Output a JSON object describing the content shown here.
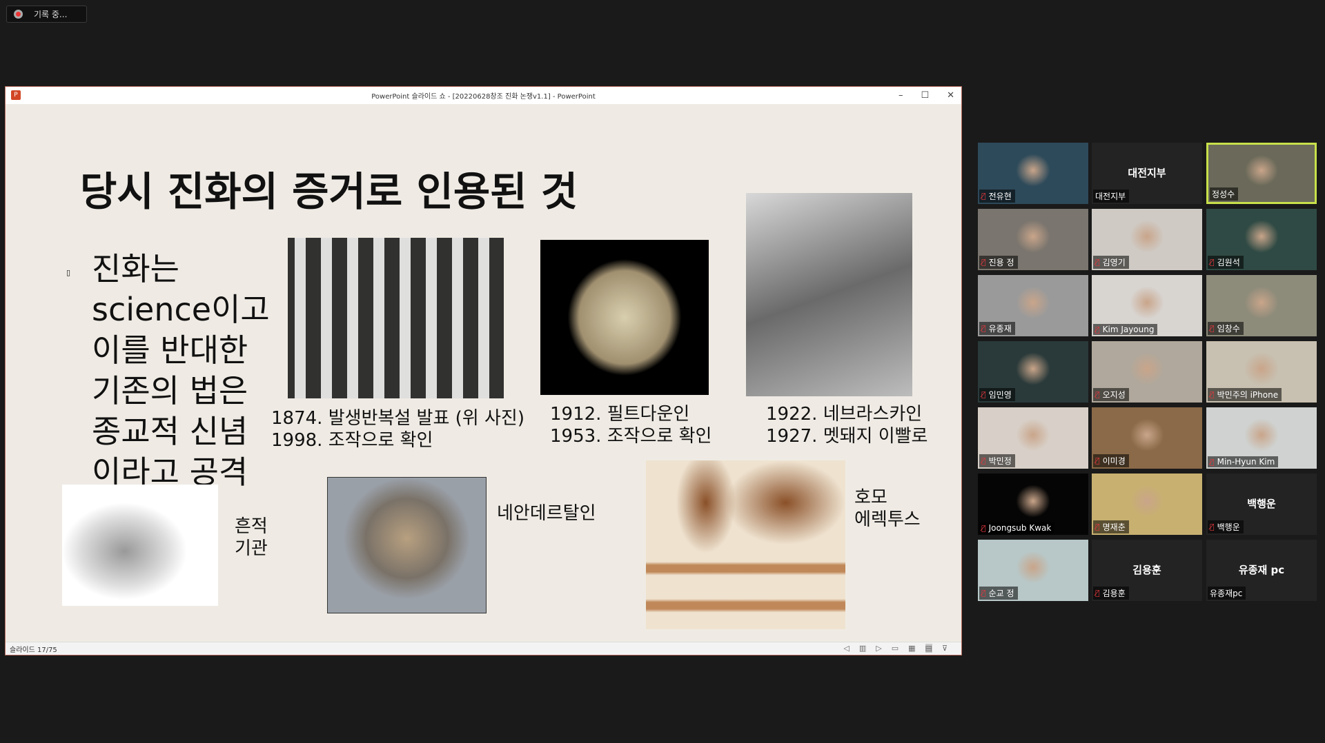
{
  "recording": {
    "label": "기록 중..."
  },
  "window": {
    "title": "PowerPoint 슬라이드 쇼 - [20220628창조 진화 논쟁v1.1] - PowerPoint",
    "minimize": "–",
    "maximize": "☐",
    "close": "✕"
  },
  "slide": {
    "title": "당시 진화의 증거로 인용된 것",
    "bullet_lines": [
      "진화는",
      "science이고",
      "이를 반대한",
      "기존의 법은",
      "종교적 신념",
      "이라고 공격"
    ],
    "captions": {
      "embryo": [
        "1874. 발생반복설 발표 (위 사진)",
        "1998. 조작으로 확인"
      ],
      "piltdown": [
        "1912. 필트다운인",
        "1953. 조작으로 확인"
      ],
      "nebraska": [
        "1922. 네브라스카인",
        "1927. 멧돼지 이빨로"
      ],
      "vestigial": [
        "흔적",
        "기관"
      ],
      "neanderthal": "네안데르탈인",
      "homo_erectus": [
        "호모",
        "에렉투스"
      ]
    }
  },
  "statusbar": {
    "slide_counter": "슬라이드 17/75"
  },
  "participants": [
    {
      "name": "전유현",
      "video": true,
      "muted": true,
      "color": "#2d4a5a"
    },
    {
      "name": "대전지부",
      "video": false,
      "muted": false,
      "display": "대전지부"
    },
    {
      "name": "정성수",
      "video": true,
      "muted": false,
      "active": true,
      "color": "#6b6a5a"
    },
    {
      "name": "진용 정",
      "video": true,
      "muted": true,
      "color": "#7a756e"
    },
    {
      "name": "김영기",
      "video": true,
      "muted": true,
      "color": "#cfcac4"
    },
    {
      "name": "김원석",
      "video": true,
      "muted": true,
      "color": "#2f4a44"
    },
    {
      "name": "유종재",
      "video": true,
      "muted": true,
      "color": "#9a9a9a"
    },
    {
      "name": "Kim Jayoung",
      "video": true,
      "muted": true,
      "color": "#d8d4d0"
    },
    {
      "name": "임창수",
      "video": true,
      "muted": true,
      "color": "#8d8b7a"
    },
    {
      "name": "임민영",
      "video": true,
      "muted": true,
      "color": "#2a3a3a"
    },
    {
      "name": "오지성",
      "video": true,
      "muted": true,
      "color": "#b0a89c"
    },
    {
      "name": "박민주의 iPhone",
      "video": true,
      "muted": true,
      "color": "#c8c0b0"
    },
    {
      "name": "박민정",
      "video": true,
      "muted": true,
      "color": "#d8d0c8"
    },
    {
      "name": "이미경",
      "video": true,
      "muted": true,
      "color": "#8a6a48"
    },
    {
      "name": "Min-Hyun Kim",
      "video": true,
      "muted": true,
      "color": "#cfd2d0"
    },
    {
      "name": "Joongsub Kwak",
      "video": true,
      "muted": true,
      "color": "#050505"
    },
    {
      "name": "명재춘",
      "video": true,
      "muted": true,
      "color": "#c8b070"
    },
    {
      "name": "백행운",
      "video": false,
      "muted": true,
      "display": "백행운"
    },
    {
      "name": "순교 정",
      "video": true,
      "muted": true,
      "color": "#b8c8c8"
    },
    {
      "name": "김용훈",
      "video": false,
      "muted": true,
      "display": "김용훈"
    },
    {
      "name": "유종재pc",
      "video": false,
      "muted": false,
      "display": "유종재 pc"
    }
  ]
}
